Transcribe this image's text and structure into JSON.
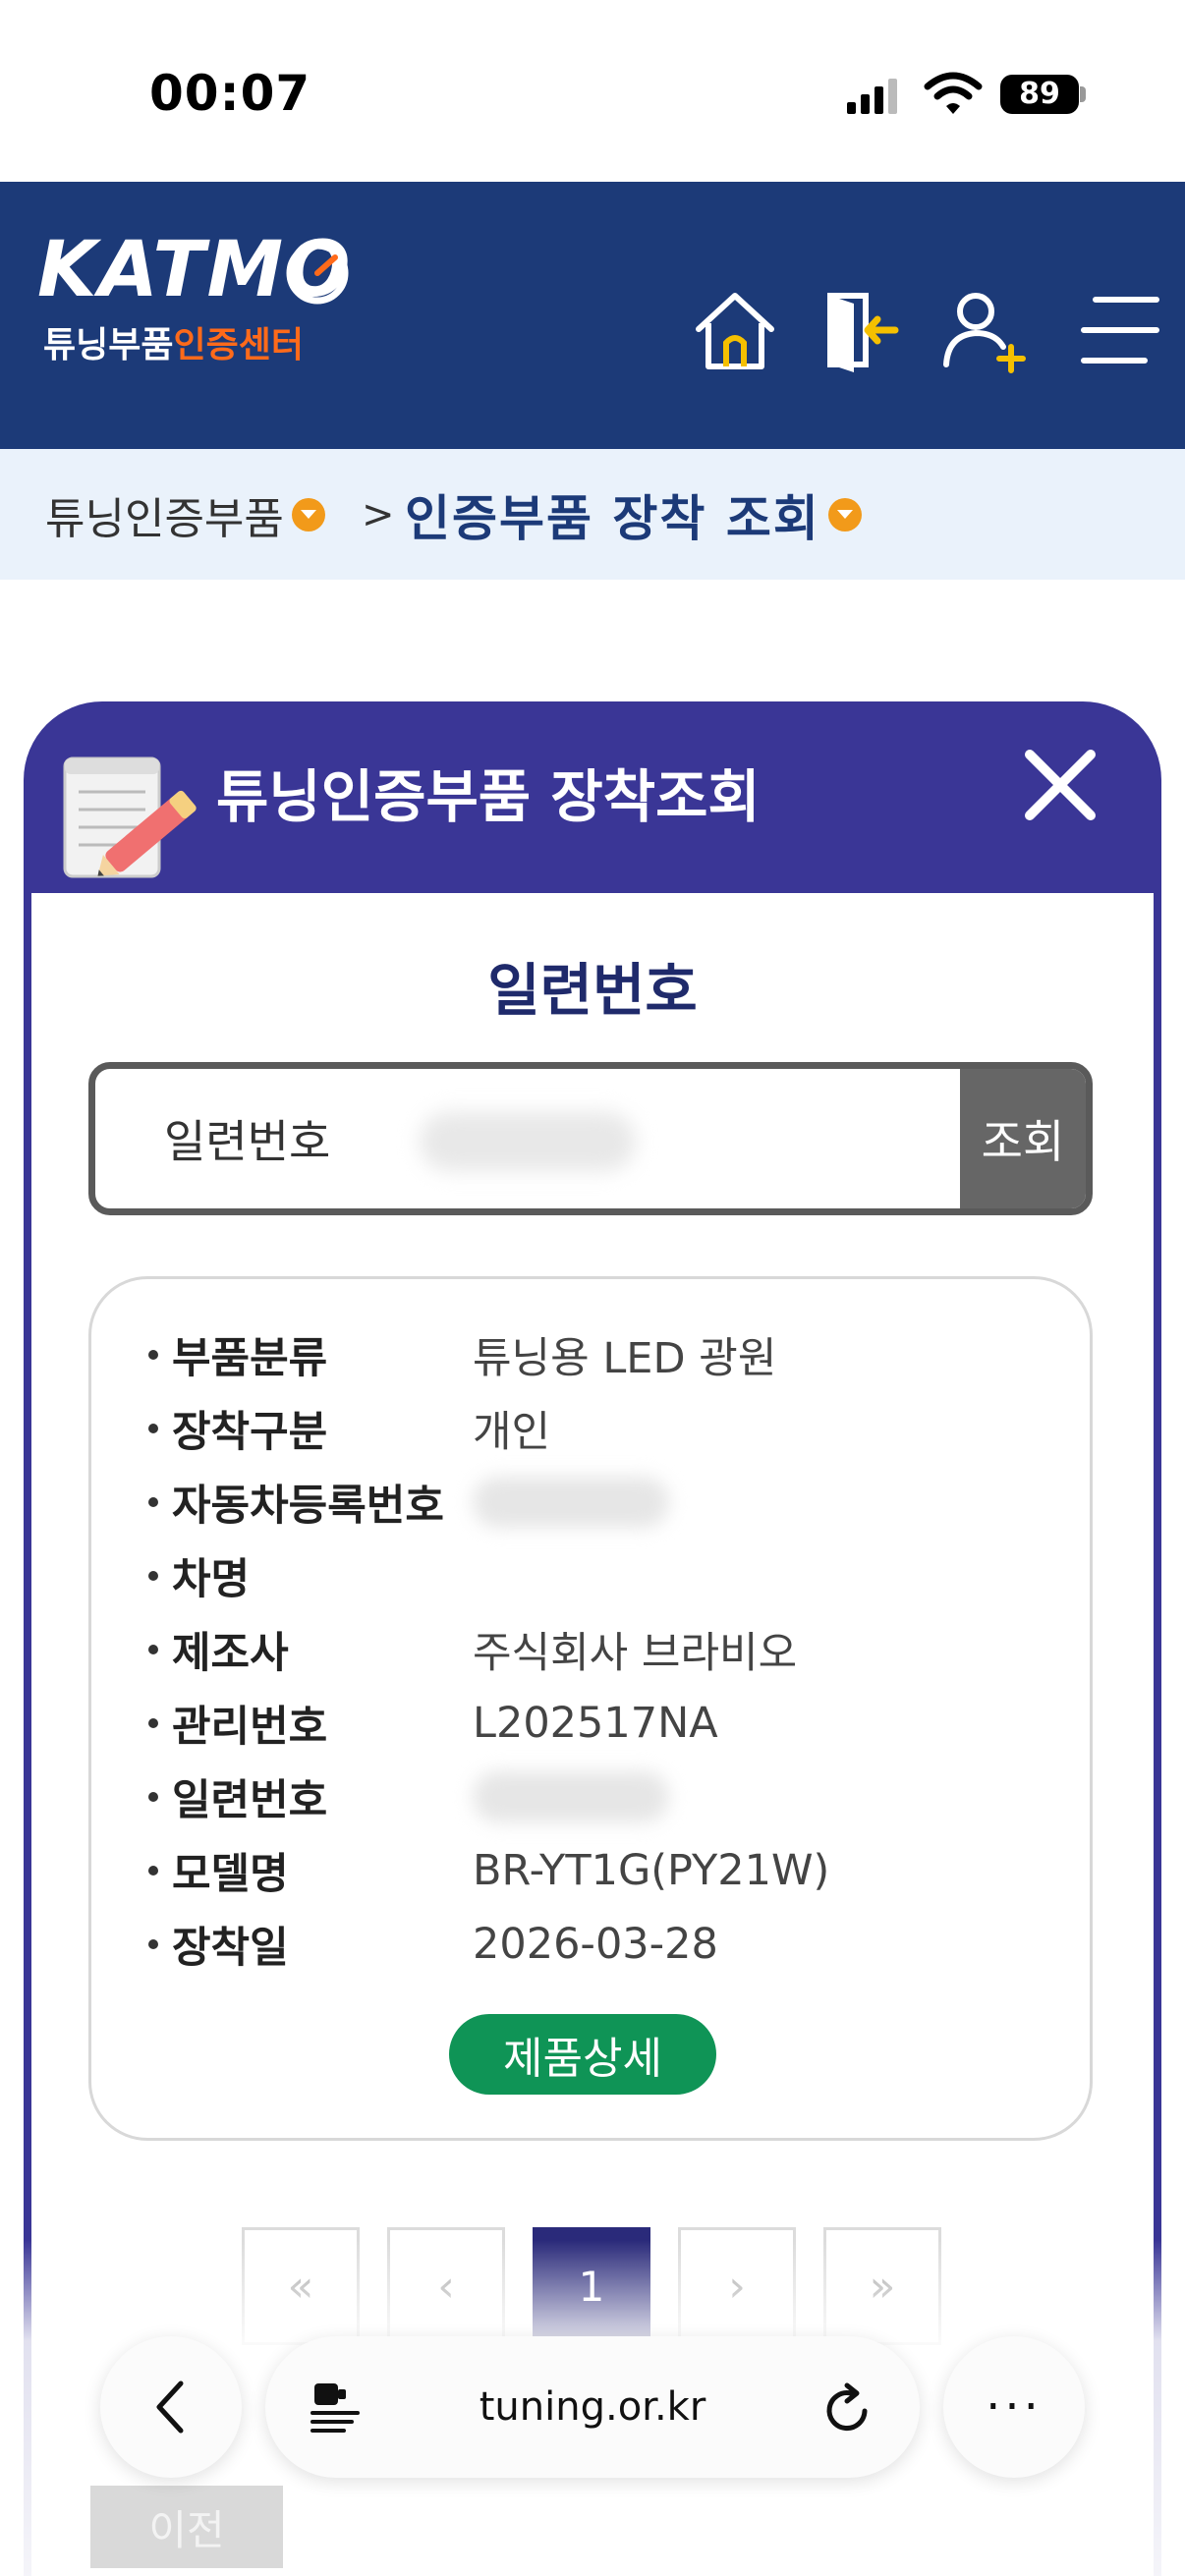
{
  "status_bar": {
    "time": "00:07",
    "battery": "89"
  },
  "header": {
    "logo_main": "KATMO",
    "logo_sub_white": "튜닝부품",
    "logo_sub_orange": "인증센터"
  },
  "breadcrumb": {
    "level1": "튜닝인증부품",
    "separator": ">",
    "level2": "인증부품 장착 조회"
  },
  "modal": {
    "title": "튜닝인증부품 장착조회",
    "section_title": "일련번호",
    "search": {
      "label": "일련번호",
      "button": "조회"
    },
    "info": [
      {
        "key": "부품분류",
        "value": "튜닝용 LED 광원"
      },
      {
        "key": "장착구분",
        "value": "개인"
      },
      {
        "key": "자동차등록번호",
        "value": ""
      },
      {
        "key": "차명",
        "value": ""
      },
      {
        "key": "제조사",
        "value": "주식회사 브라비오"
      },
      {
        "key": "관리번호",
        "value": "L202517NA"
      },
      {
        "key": "일련번호",
        "value": ""
      },
      {
        "key": "모델명",
        "value": "BR-YT1G(PY21W)"
      },
      {
        "key": "장착일",
        "value": "2026-03-28"
      }
    ],
    "detail_button": "제품상세",
    "pager": {
      "first": "«",
      "prev": "‹",
      "current": "1",
      "next": "›",
      "last": "»"
    },
    "prev_button": "이전"
  },
  "browser": {
    "url": "tuning.or.kr",
    "more": "···"
  },
  "colors": {
    "header_bg": "#1c3a78",
    "modal_bg": "#3a3696",
    "accent_orange": "#ff6a1a",
    "detail_green": "#0f9456"
  }
}
